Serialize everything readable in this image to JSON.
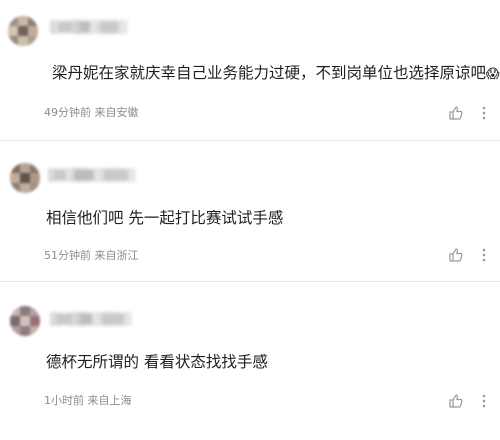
{
  "comments": [
    {
      "text": "梁丹妮在家就庆幸自己业务能力过硬，不到岗单位也选择原谅吧",
      "emoji": "😱",
      "meta": "49分钟前 来自安徽",
      "like_icon": "thumbs-up-icon",
      "more_icon": "more-vertical-icon"
    },
    {
      "text": "相信他们吧 先一起打比赛试试手感",
      "meta": "51分钟前 来自浙江",
      "like_icon": "thumbs-up-icon",
      "more_icon": "more-vertical-icon"
    },
    {
      "text": "德杯无所谓的 看看状态找找手感",
      "meta": "1小时前 来自上海",
      "like_icon": "thumbs-up-icon",
      "more_icon": "more-vertical-icon"
    }
  ],
  "colors": {
    "text": "#1f1f1f",
    "meta": "#8c8c8c",
    "icon": "#9a9a9a",
    "divider": "#e8e8e8"
  }
}
